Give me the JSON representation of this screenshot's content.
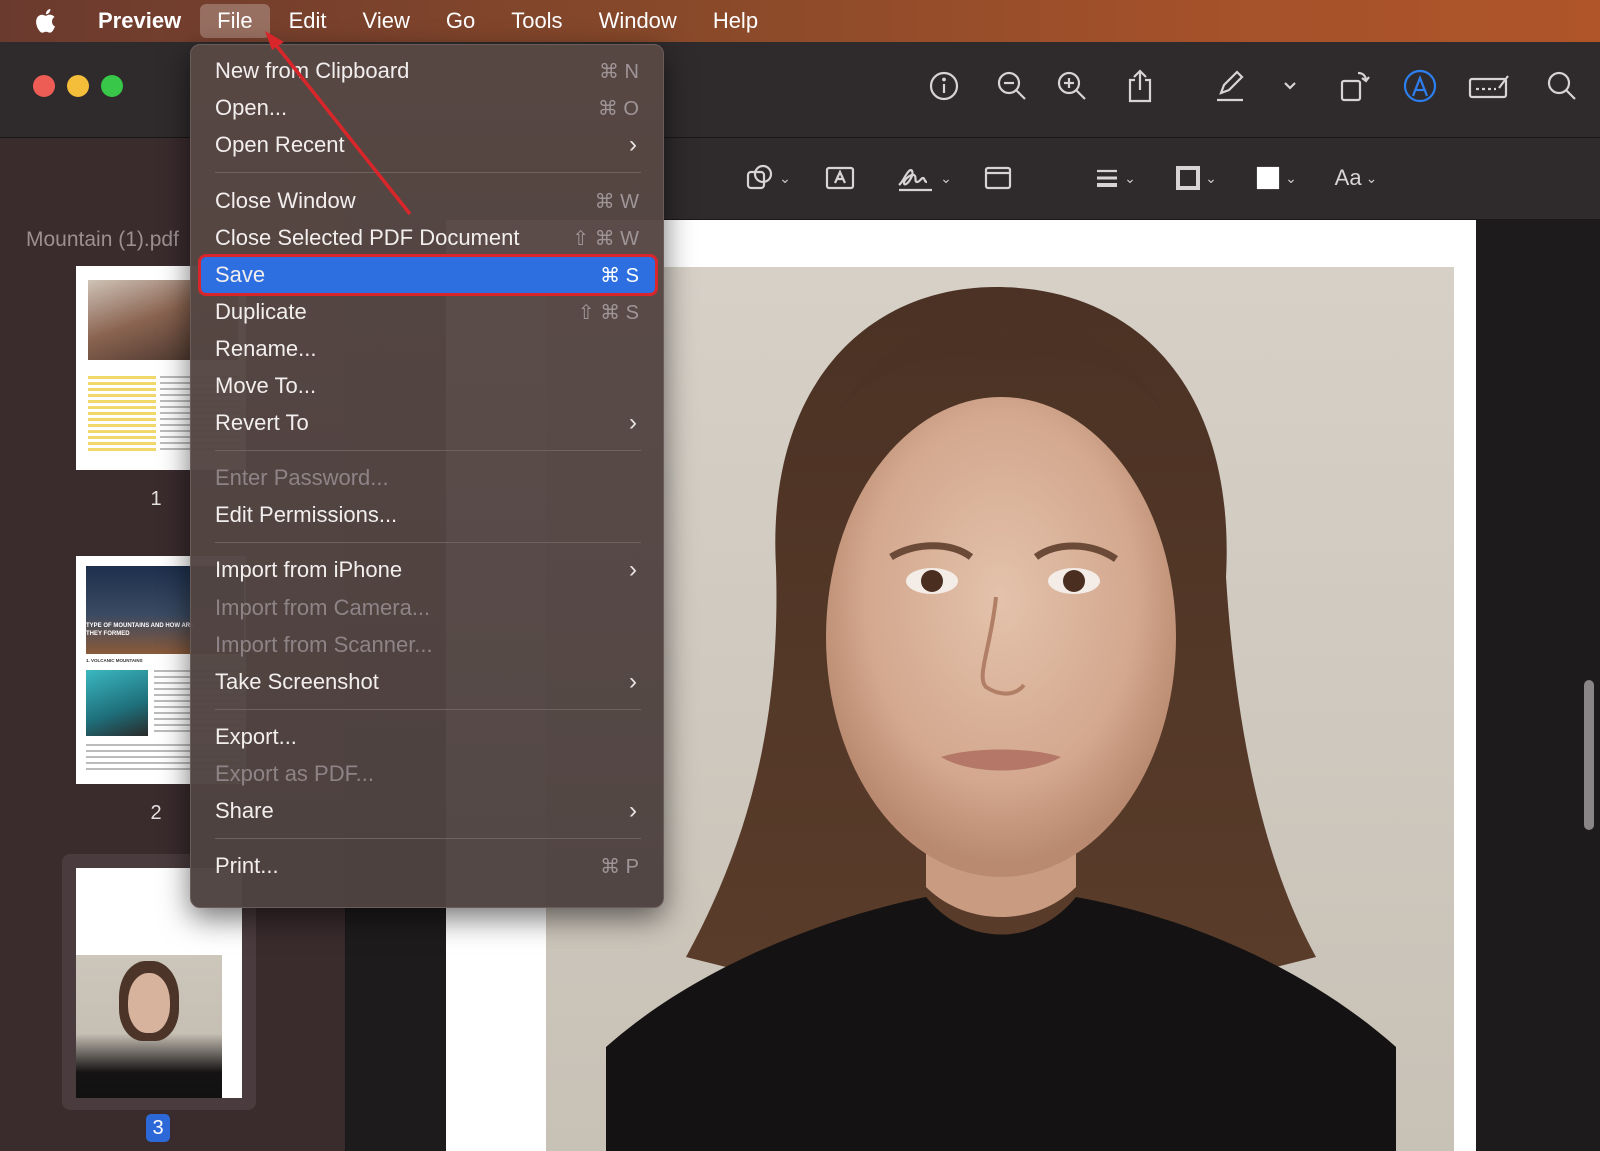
{
  "menubar": {
    "app_name": "Preview",
    "items": [
      "File",
      "Edit",
      "View",
      "Go",
      "Tools",
      "Window",
      "Help"
    ]
  },
  "sidebar": {
    "document_title": "Mountain (1).pdf",
    "pages": [
      {
        "label": "1",
        "heading": ""
      },
      {
        "label": "2",
        "heading": "TYPE OF MOUNTAINS AND HOW ARE THEY FORMED",
        "subheading": "1. VOLCANIC MOUNTAINS"
      },
      {
        "label": "3",
        "heading": ""
      }
    ]
  },
  "annotation_toolbar": {
    "font_button": "Aa"
  },
  "file_menu": {
    "items": [
      {
        "label": "New from Clipboard",
        "shortcut": "⌘ N"
      },
      {
        "label": "Open...",
        "shortcut": "⌘ O"
      },
      {
        "label": "Open Recent",
        "submenu": "›"
      },
      {
        "label": "Close Window",
        "shortcut": "⌘ W"
      },
      {
        "label": "Close Selected PDF Document",
        "shortcut": "⇧ ⌘ W"
      },
      {
        "label": "Save",
        "shortcut": "⌘ S"
      },
      {
        "label": "Duplicate",
        "shortcut": "⇧ ⌘ S"
      },
      {
        "label": "Rename..."
      },
      {
        "label": "Move To..."
      },
      {
        "label": "Revert To",
        "submenu": "›"
      },
      {
        "label": "Enter Password..."
      },
      {
        "label": "Edit Permissions..."
      },
      {
        "label": "Import from iPhone",
        "submenu": "›"
      },
      {
        "label": "Import from Camera..."
      },
      {
        "label": "Import from Scanner..."
      },
      {
        "label": "Take Screenshot",
        "submenu": "›"
      },
      {
        "label": "Export..."
      },
      {
        "label": "Export as PDF..."
      },
      {
        "label": "Share",
        "submenu": "›"
      },
      {
        "label": "Print...",
        "shortcut": "⌘ P"
      }
    ],
    "highlighted": "Save"
  },
  "colors": {
    "highlight": "#2d6fe0",
    "annotation_red": "#d9262a",
    "markup_accent": "#2d7ff0"
  }
}
